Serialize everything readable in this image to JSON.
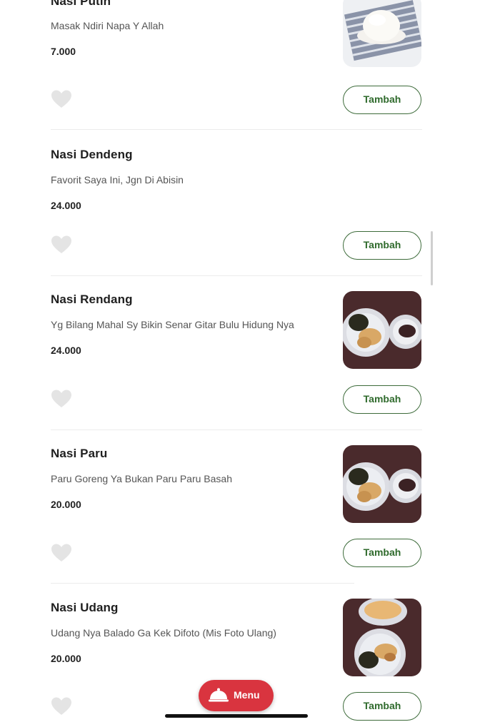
{
  "items": [
    {
      "name": "Nasi Putih",
      "description": "Masak Ndiri Napa Y Allah",
      "price": "7.000",
      "add_label": "Tambah",
      "photo": "rice-bowl"
    },
    {
      "name": "Nasi Dendeng",
      "description": "Favorit Saya Ini, Jgn Di Abisin",
      "price": "24.000",
      "add_label": "Tambah",
      "photo": ""
    },
    {
      "name": "Nasi Rendang",
      "description": "Yg Bilang Mahal Sy Bikin Senar Gitar Bulu Hidung Nya",
      "price": "24.000",
      "add_label": "Tambah",
      "photo": "rendang-plates"
    },
    {
      "name": "Nasi Paru",
      "description": "Paru Goreng Ya Bukan Paru Paru Basah",
      "price": "20.000",
      "add_label": "Tambah",
      "photo": "paru-plates"
    },
    {
      "name": "Nasi Udang",
      "description": "Udang Nya Balado Ga Kek Difoto (Mis Foto Ulang)",
      "price": "20.000",
      "add_label": "Tambah",
      "photo": "udang-plates"
    }
  ],
  "menu_button": {
    "label": "Menu",
    "icon": "cloche-icon"
  },
  "colors": {
    "accent_green": "#2f6a2c",
    "menu_red": "#d9343f",
    "heart_gray": "#e4e4e4"
  }
}
